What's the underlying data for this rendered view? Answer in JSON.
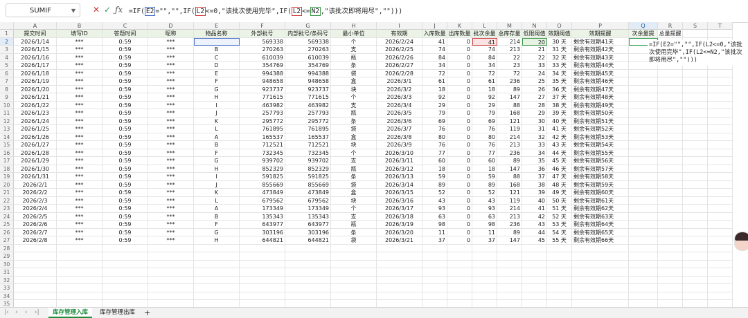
{
  "name_box": "SUMIF",
  "formula": {
    "p1": "=IF(",
    "r1": "E2",
    "p2": "=\"\",\"\",IF(",
    "r2": "L2",
    "p3": "<=0,\"该批次使用完毕\",IF(",
    "r3": "L2",
    "p4": "<=",
    "r4": "N2",
    "p5": ",\"该批次即将用尽\",\"\")))"
  },
  "columns": [
    "A",
    "B",
    "C",
    "D",
    "E",
    "F",
    "G",
    "H",
    "I",
    "J",
    "K",
    "L",
    "M",
    "N",
    "O",
    "P",
    "Q",
    "R",
    "S",
    "T"
  ],
  "headers": [
    "提交时间",
    "填写ID",
    "答题时间",
    "昵称",
    "物品名称",
    "外部批号",
    "内部批号/条码号",
    "最小单位",
    "有效期",
    "入库数量",
    "出库数量",
    "批次余量",
    "总库存量",
    "低限阈值",
    "效期阈值",
    "效期提醒",
    "次余量提",
    "总量提醒",
    "",
    ""
  ],
  "rows": [
    [
      "2026/1/14",
      "***",
      "0:59",
      "***",
      "",
      "569338",
      "569338",
      "个",
      "2026/2/24",
      "41",
      "0",
      "41",
      "214",
      "20",
      "30 天",
      "剩余有效期41天"
    ],
    [
      "2026/1/15",
      "***",
      "0:59",
      "***",
      "B",
      "270263",
      "270263",
      "支",
      "2026/2/25",
      "74",
      "0",
      "74",
      "213",
      "21",
      "31 天",
      "剩余有效期42天"
    ],
    [
      "2026/1/16",
      "***",
      "0:59",
      "***",
      "C",
      "610039",
      "610039",
      "瓶",
      "2026/2/26",
      "84",
      "0",
      "84",
      "22",
      "22",
      "32 天",
      "剩余有效期43天"
    ],
    [
      "2026/1/17",
      "***",
      "0:59",
      "***",
      "D",
      "354769",
      "354769",
      "条",
      "2026/2/27",
      "34",
      "0",
      "34",
      "23",
      "33",
      "33 天",
      "剩余有效期44天"
    ],
    [
      "2026/1/18",
      "***",
      "0:59",
      "***",
      "E",
      "994388",
      "994388",
      "袋",
      "2026/2/28",
      "72",
      "0",
      "72",
      "72",
      "24",
      "34 天",
      "剩余有效期45天"
    ],
    [
      "2026/1/19",
      "***",
      "0:59",
      "***",
      "F",
      "948658",
      "948658",
      "盒",
      "2026/3/1",
      "61",
      "0",
      "61",
      "236",
      "25",
      "35 天",
      "剩余有效期46天"
    ],
    [
      "2026/1/20",
      "***",
      "0:59",
      "***",
      "G",
      "923737",
      "923737",
      "块",
      "2026/3/2",
      "18",
      "0",
      "18",
      "89",
      "26",
      "36 天",
      "剩余有效期47天"
    ],
    [
      "2026/1/21",
      "***",
      "0:59",
      "***",
      "H",
      "771615",
      "771615",
      "个",
      "2026/3/3",
      "92",
      "0",
      "92",
      "147",
      "27",
      "37 天",
      "剩余有效期48天"
    ],
    [
      "2026/1/22",
      "***",
      "0:59",
      "***",
      "I",
      "463982",
      "463982",
      "支",
      "2026/3/4",
      "29",
      "0",
      "29",
      "88",
      "28",
      "38 天",
      "剩余有效期49天"
    ],
    [
      "2026/1/23",
      "***",
      "0:59",
      "***",
      "J",
      "257793",
      "257793",
      "瓶",
      "2026/3/5",
      "79",
      "0",
      "79",
      "168",
      "29",
      "39 天",
      "剩余有效期50天"
    ],
    [
      "2026/1/24",
      "***",
      "0:59",
      "***",
      "K",
      "295772",
      "295772",
      "条",
      "2026/3/6",
      "69",
      "0",
      "69",
      "121",
      "30",
      "40 天",
      "剩余有效期51天"
    ],
    [
      "2026/1/25",
      "***",
      "0:59",
      "***",
      "L",
      "761895",
      "761895",
      "袋",
      "2026/3/7",
      "76",
      "0",
      "76",
      "119",
      "31",
      "41 天",
      "剩余有效期52天"
    ],
    [
      "2026/1/26",
      "***",
      "0:59",
      "***",
      "A",
      "165537",
      "165537",
      "盒",
      "2026/3/8",
      "80",
      "0",
      "80",
      "214",
      "32",
      "42 天",
      "剩余有效期53天"
    ],
    [
      "2026/1/27",
      "***",
      "0:59",
      "***",
      "B",
      "712521",
      "712521",
      "块",
      "2026/3/9",
      "76",
      "0",
      "76",
      "213",
      "33",
      "43 天",
      "剩余有效期54天"
    ],
    [
      "2026/1/28",
      "***",
      "0:59",
      "***",
      "F",
      "732345",
      "732345",
      "个",
      "2026/3/10",
      "77",
      "0",
      "77",
      "236",
      "34",
      "44 天",
      "剩余有效期55天"
    ],
    [
      "2026/1/29",
      "***",
      "0:59",
      "***",
      "G",
      "939702",
      "939702",
      "支",
      "2026/3/11",
      "60",
      "0",
      "60",
      "89",
      "35",
      "45 天",
      "剩余有效期56天"
    ],
    [
      "2026/1/30",
      "***",
      "0:59",
      "***",
      "H",
      "852329",
      "852329",
      "瓶",
      "2026/3/12",
      "18",
      "0",
      "18",
      "147",
      "36",
      "46 天",
      "剩余有效期57天"
    ],
    [
      "2026/1/31",
      "***",
      "0:59",
      "***",
      "I",
      "591825",
      "591825",
      "条",
      "2026/3/13",
      "59",
      "0",
      "59",
      "88",
      "37",
      "47 天",
      "剩余有效期58天"
    ],
    [
      "2026/2/1",
      "***",
      "0:59",
      "***",
      "J",
      "855669",
      "855669",
      "袋",
      "2026/3/14",
      "89",
      "0",
      "89",
      "168",
      "38",
      "48 天",
      "剩余有效期59天"
    ],
    [
      "2026/2/2",
      "***",
      "0:59",
      "***",
      "K",
      "473849",
      "473849",
      "盒",
      "2026/3/15",
      "52",
      "0",
      "52",
      "121",
      "39",
      "49 天",
      "剩余有效期60天"
    ],
    [
      "2026/2/3",
      "***",
      "0:59",
      "***",
      "L",
      "679562",
      "679562",
      "块",
      "2026/3/16",
      "43",
      "0",
      "43",
      "119",
      "40",
      "50 天",
      "剩余有效期61天"
    ],
    [
      "2026/2/4",
      "***",
      "0:59",
      "***",
      "A",
      "173349",
      "173349",
      "个",
      "2026/3/17",
      "93",
      "0",
      "93",
      "214",
      "41",
      "51 天",
      "剩余有效期62天"
    ],
    [
      "2026/2/5",
      "***",
      "0:59",
      "***",
      "B",
      "135343",
      "135343",
      "支",
      "2026/3/18",
      "63",
      "0",
      "63",
      "213",
      "42",
      "52 天",
      "剩余有效期63天"
    ],
    [
      "2026/2/6",
      "***",
      "0:59",
      "***",
      "F",
      "643977",
      "643977",
      "瓶",
      "2026/3/19",
      "98",
      "0",
      "98",
      "236",
      "43",
      "53 天",
      "剩余有效期64天"
    ],
    [
      "2026/2/7",
      "***",
      "0:59",
      "***",
      "G",
      "303196",
      "303196",
      "条",
      "2026/3/20",
      "11",
      "0",
      "11",
      "89",
      "44",
      "54 天",
      "剩余有效期65天"
    ],
    [
      "2026/2/8",
      "***",
      "0:59",
      "***",
      "H",
      "644821",
      "644821",
      "袋",
      "2026/3/21",
      "37",
      "0",
      "37",
      "147",
      "45",
      "55 天",
      "剩余有效期66天"
    ]
  ],
  "row_numbers": [
    "1",
    "2",
    "3",
    "4",
    "5",
    "6",
    "7",
    "8",
    "9",
    "10",
    "11",
    "12",
    "13",
    "14",
    "15",
    "16",
    "17",
    "18",
    "19",
    "20",
    "21",
    "22",
    "23",
    "24",
    "25",
    "26",
    "27",
    "28",
    "29",
    "30",
    "31",
    "32",
    "33",
    "34",
    "35"
  ],
  "edit_text": "=IF(E2=\"\",\"\",IF(L2<=0,\"该批次使用完毕\",IF(L2<=N2,\"该批次即将用尽\",\"\")))",
  "tabs": [
    "库存管理入库",
    "库存管理出库"
  ],
  "add_tab": "+",
  "icons": {
    "cancel": "close-icon",
    "confirm": "check-icon",
    "fx": "fx-icon"
  }
}
